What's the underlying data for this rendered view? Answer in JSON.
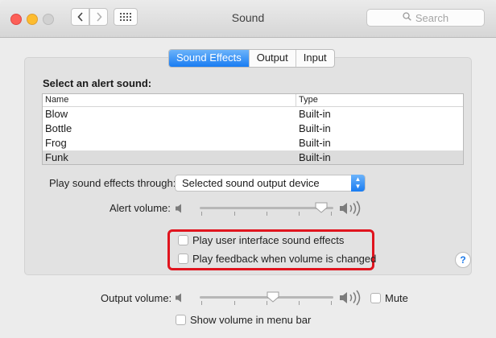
{
  "window": {
    "title": "Sound",
    "search_placeholder": "Search"
  },
  "icons": {
    "back": "chevron-left-icon",
    "forward": "chevron-right-icon",
    "grid": "grid-icon",
    "search": "magnifier-icon",
    "speaker_low": "speaker-low-icon",
    "speaker_high": "speaker-high-icon",
    "help": "question-mark-icon"
  },
  "tabs": [
    {
      "label": "Sound Effects",
      "active": true
    },
    {
      "label": "Output",
      "active": false
    },
    {
      "label": "Input",
      "active": false
    }
  ],
  "alert": {
    "heading": "Select an alert sound:",
    "columns": [
      "Name",
      "Type"
    ],
    "rows": [
      {
        "name": "Blow",
        "type": "Built-in"
      },
      {
        "name": "Bottle",
        "type": "Built-in"
      },
      {
        "name": "Frog",
        "type": "Built-in"
      },
      {
        "name": "Funk",
        "type": "Built-in",
        "selected": true
      }
    ]
  },
  "play_through": {
    "label": "Play sound effects through:",
    "value": "Selected sound output device"
  },
  "alert_volume": {
    "label": "Alert volume:",
    "level": 0.95
  },
  "options": {
    "ui_sounds": {
      "label": "Play user interface sound effects",
      "checked": false
    },
    "feedback": {
      "label": "Play feedback when volume is changed",
      "checked": false
    }
  },
  "help_label": "?",
  "output_volume": {
    "label": "Output volume:",
    "level": 0.55,
    "mute_label": "Mute",
    "mute_checked": false
  },
  "menu_bar": {
    "label": "Show volume in menu bar",
    "checked": false
  },
  "colors": {
    "accent": "#197cf2",
    "highlight_box": "#e0141e"
  }
}
